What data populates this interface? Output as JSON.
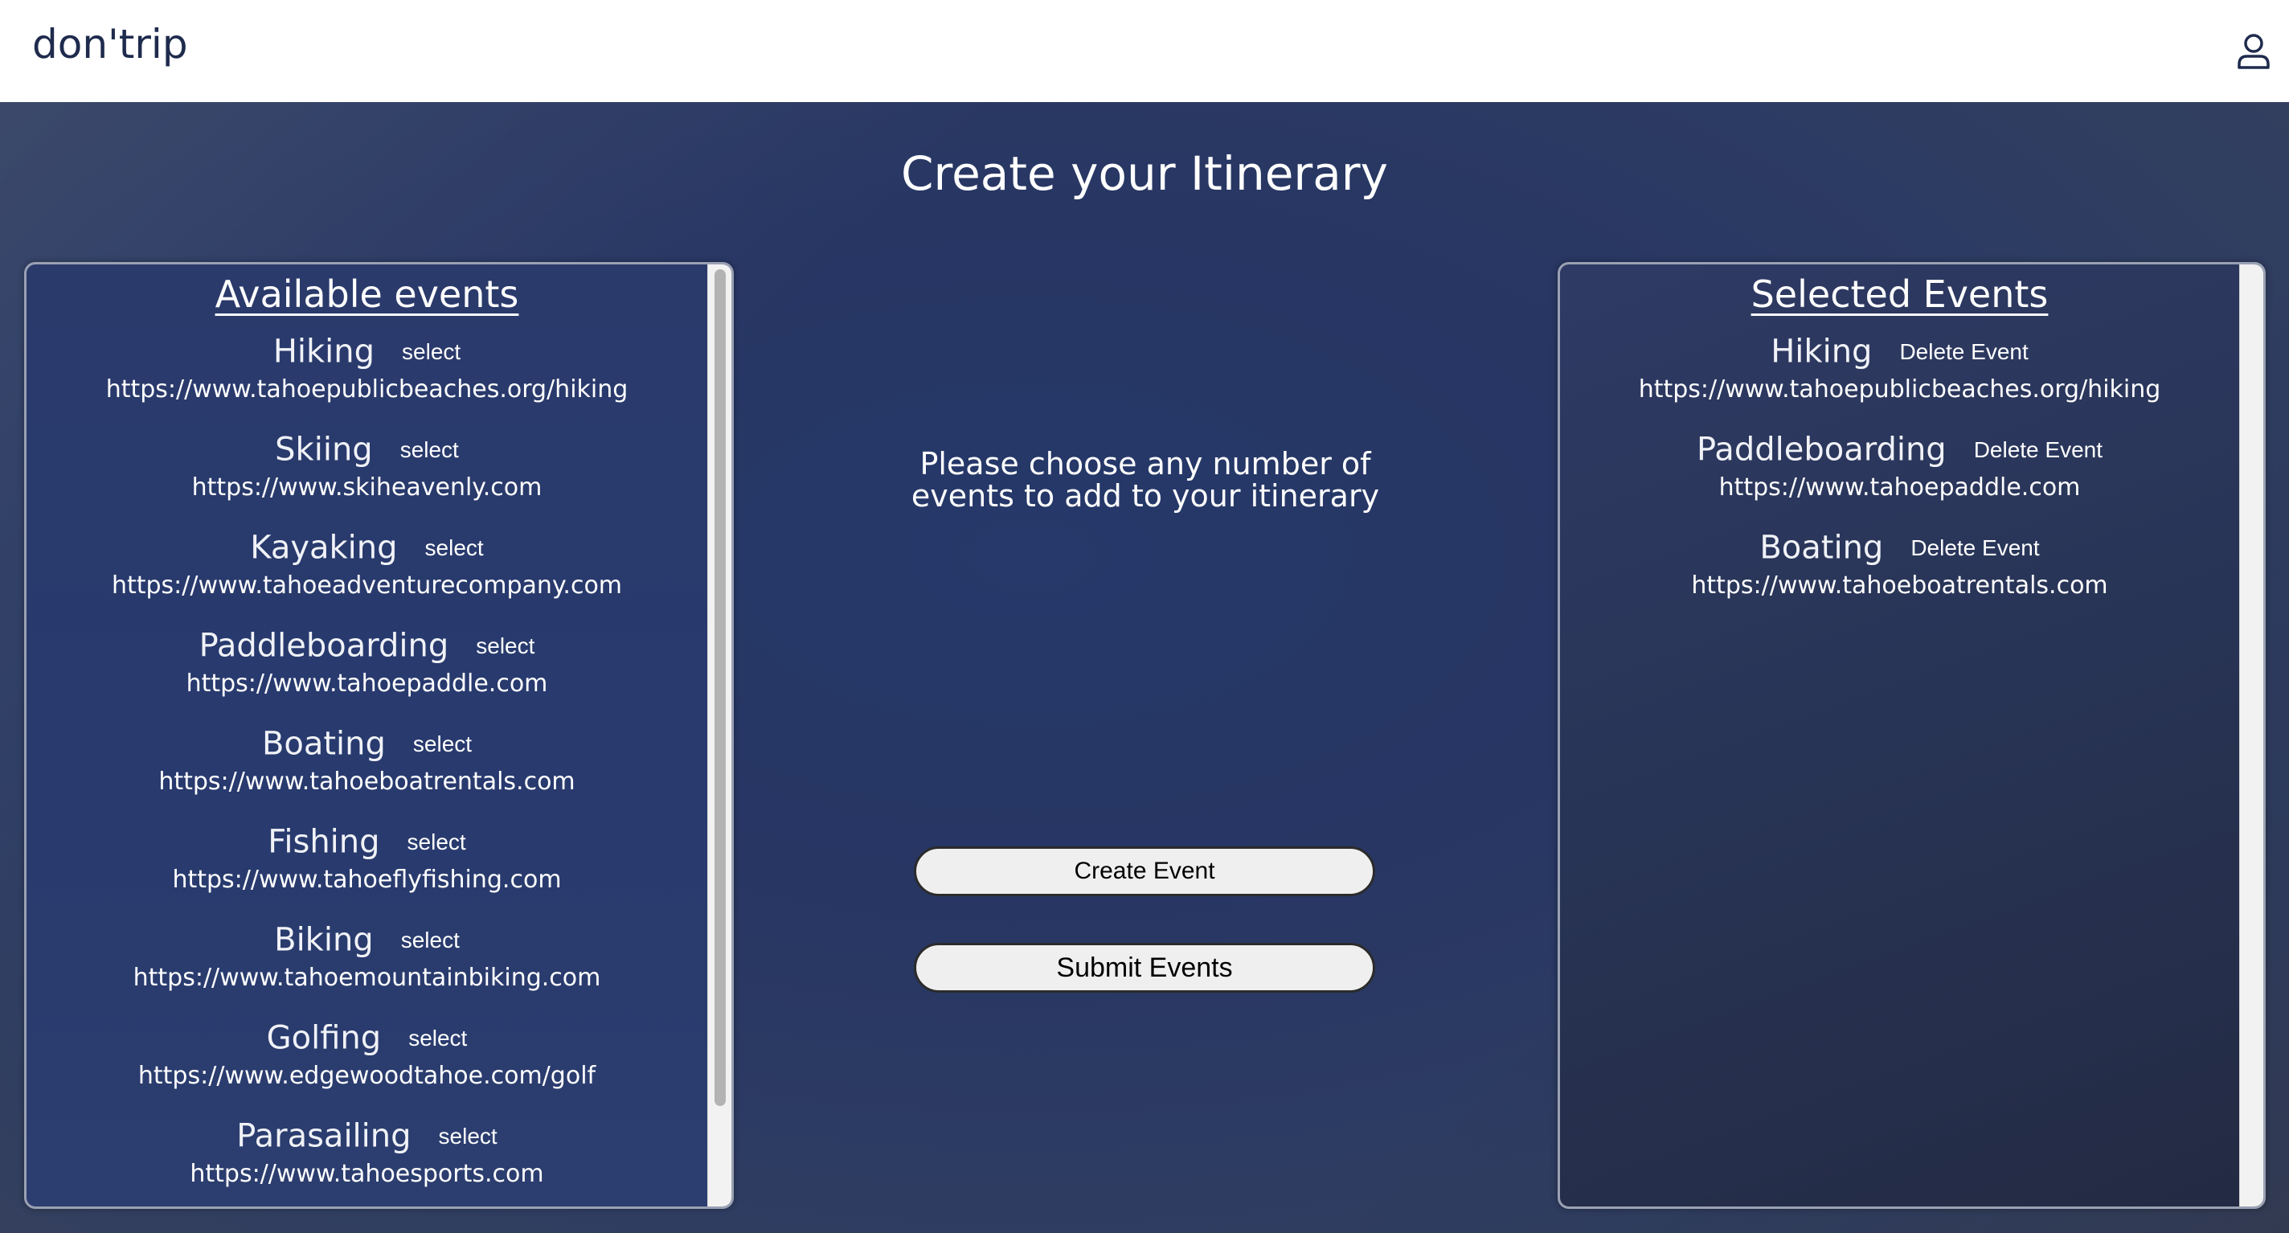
{
  "header": {
    "brand": "don'trip",
    "user_icon": "user-icon"
  },
  "page": {
    "title": "Create your Itinerary",
    "instructions": "Please choose any number of events to add to your itinerary"
  },
  "available": {
    "heading": "Available events",
    "action_label": "select",
    "items": [
      {
        "name": "Hiking",
        "url": "https://www.tahoepublicbeaches.org/hiking"
      },
      {
        "name": "Skiing",
        "url": "https://www.skiheavenly.com"
      },
      {
        "name": "Kayaking",
        "url": "https://www.tahoeadventurecompany.com"
      },
      {
        "name": "Paddleboarding",
        "url": "https://www.tahoepaddle.com"
      },
      {
        "name": "Boating",
        "url": "https://www.tahoeboatrentals.com"
      },
      {
        "name": "Fishing",
        "url": "https://www.tahoeflyfishing.com"
      },
      {
        "name": "Biking",
        "url": "https://www.tahoemountainbiking.com"
      },
      {
        "name": "Golfing",
        "url": "https://www.edgewoodtahoe.com/golf"
      },
      {
        "name": "Parasailing",
        "url": "https://www.tahoesports.com"
      }
    ]
  },
  "selected": {
    "heading": "Selected Events",
    "action_label": "Delete Event",
    "items": [
      {
        "name": "Hiking",
        "url": "https://www.tahoepublicbeaches.org/hiking"
      },
      {
        "name": "Paddleboarding",
        "url": "https://www.tahoepaddle.com"
      },
      {
        "name": "Boating",
        "url": "https://www.tahoeboatrentals.com"
      }
    ]
  },
  "buttons": {
    "create": "Create Event",
    "submit": "Submit Events"
  }
}
